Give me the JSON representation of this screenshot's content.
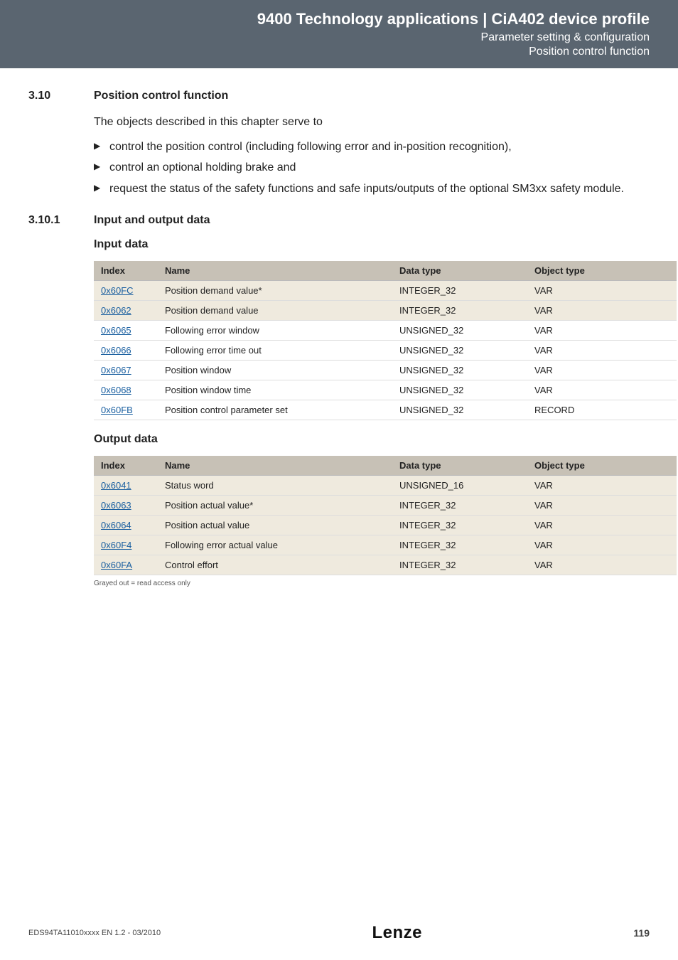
{
  "header": {
    "title": "9400 Technology applications | CiA402 device profile",
    "sub1": "Parameter setting & configuration",
    "sub2": "Position control function"
  },
  "sections": {
    "s310": {
      "num": "3.10",
      "title": "Position control function"
    },
    "s3101": {
      "num": "3.10.1",
      "title": "Input and output data"
    }
  },
  "intro_text": "The objects described in this chapter serve to",
  "bullets": [
    "control the position control (including following error and in-position recognition),",
    "control an optional holding brake and",
    "request the status of the safety functions and safe inputs/outputs of the optional SM3xx safety module."
  ],
  "input_heading": "Input data",
  "output_heading": "Output data",
  "table_headers": {
    "index": "Index",
    "name": "Name",
    "dtype": "Data type",
    "otype": "Object type"
  },
  "input_table": [
    {
      "index": "0x60FC",
      "name": "Position demand value*",
      "dtype": "INTEGER_32",
      "otype": "VAR",
      "shaded": true
    },
    {
      "index": "0x6062",
      "name": "Position demand value",
      "dtype": "INTEGER_32",
      "otype": "VAR",
      "shaded": true
    },
    {
      "index": "0x6065",
      "name": "Following error window",
      "dtype": "UNSIGNED_32",
      "otype": "VAR",
      "shaded": false
    },
    {
      "index": "0x6066",
      "name": "Following error time out",
      "dtype": "UNSIGNED_32",
      "otype": "VAR",
      "shaded": false
    },
    {
      "index": "0x6067",
      "name": "Position window",
      "dtype": "UNSIGNED_32",
      "otype": "VAR",
      "shaded": false
    },
    {
      "index": "0x6068",
      "name": "Position window time",
      "dtype": "UNSIGNED_32",
      "otype": "VAR",
      "shaded": false
    },
    {
      "index": "0x60FB",
      "name": "Position control parameter set",
      "dtype": "UNSIGNED_32",
      "otype": "RECORD",
      "shaded": false
    }
  ],
  "output_table": [
    {
      "index": "0x6041",
      "name": "Status word",
      "dtype": "UNSIGNED_16",
      "otype": "VAR",
      "shaded": true
    },
    {
      "index": "0x6063",
      "name": "Position actual value*",
      "dtype": "INTEGER_32",
      "otype": "VAR",
      "shaded": true
    },
    {
      "index": "0x6064",
      "name": "Position actual value",
      "dtype": "INTEGER_32",
      "otype": "VAR",
      "shaded": true
    },
    {
      "index": "0x60F4",
      "name": "Following error actual value",
      "dtype": "INTEGER_32",
      "otype": "VAR",
      "shaded": true
    },
    {
      "index": "0x60FA",
      "name": "Control effort",
      "dtype": "INTEGER_32",
      "otype": "VAR",
      "shaded": true
    }
  ],
  "footnote": "Grayed out = read access only",
  "footer": {
    "left": "EDS94TA11010xxxx EN 1.2 - 03/2010",
    "logo": "Lenze",
    "page": "119"
  }
}
